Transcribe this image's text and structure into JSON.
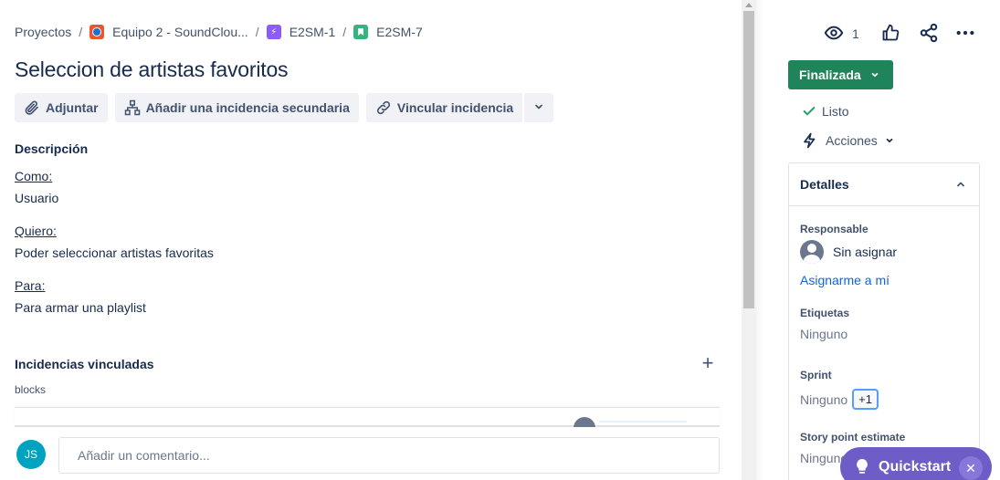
{
  "breadcrumb": {
    "items": [
      {
        "label": "Proyectos"
      },
      {
        "label": "Equipo 2 - SoundClou..."
      },
      {
        "label": "E2SM-1"
      },
      {
        "label": "E2SM-7"
      }
    ],
    "separator": "/"
  },
  "issue": {
    "title": "Seleccion de artistas favoritos"
  },
  "toolbar": {
    "attach_label": "Adjuntar",
    "add_child_label": "Añadir una incidencia secundaria",
    "link_label": "Vincular incidencia"
  },
  "description": {
    "heading": "Descripción",
    "sections": [
      {
        "label": "Como:",
        "text": "Usuario"
      },
      {
        "label": "Quiero:",
        "text": "Poder seleccionar artistas favoritas"
      },
      {
        "label": "Para:",
        "text": "Para armar una playlist"
      }
    ]
  },
  "linked": {
    "heading": "Incidencias vinculadas",
    "relation": "blocks"
  },
  "comment": {
    "avatar_initials": "JS",
    "placeholder": "Añadir un comentario..."
  },
  "sidebar": {
    "watch_count": "1",
    "status_label": "Finalizada",
    "resolution_label": "Listo",
    "actions_label": "Acciones",
    "details": {
      "heading": "Detalles",
      "assignee_label": "Responsable",
      "assignee_value": "Sin asignar",
      "assign_me": "Asignarme a mí",
      "labels_label": "Etiquetas",
      "labels_value": "Ninguno",
      "sprint_label": "Sprint",
      "sprint_value": "Ninguno",
      "sprint_badge": "+1",
      "story_points_label": "Story point estimate",
      "story_points_value": "Ninguno"
    }
  },
  "quickstart": {
    "label": "Quickstart"
  },
  "colors": {
    "status_green": "#1f845a",
    "quickstart_purple": "#6e5dc6",
    "link_blue": "#0c66e4"
  }
}
